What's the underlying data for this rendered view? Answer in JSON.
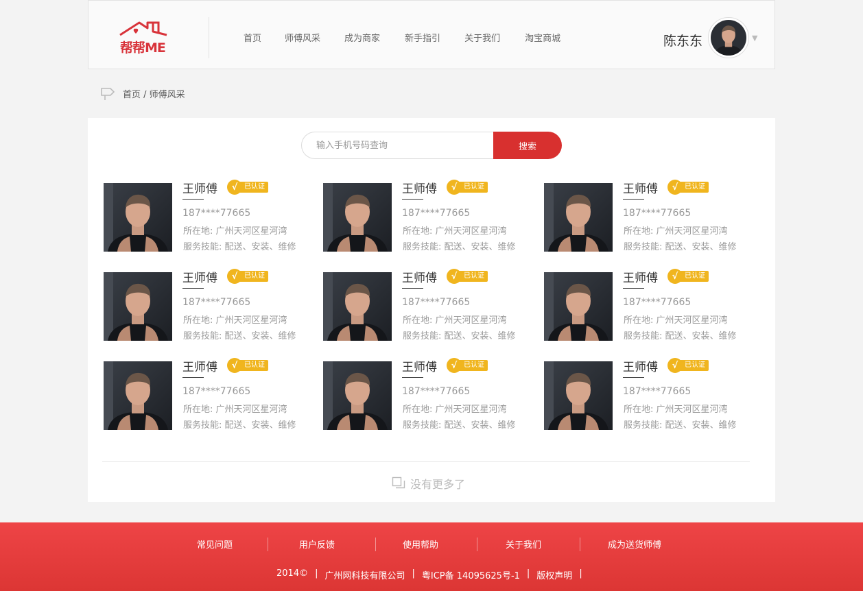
{
  "header": {
    "logo_text": "帮帮ME",
    "nav": [
      "首页",
      "师傅风采",
      "成为商家",
      "新手指引",
      "关于我们",
      "淘宝商城"
    ],
    "user_name": "陈东东"
  },
  "breadcrumb": "首页 / 师傅风采",
  "search": {
    "placeholder": "输入手机号码查询",
    "button": "搜索"
  },
  "badge_label": "已认证",
  "badge_mark": "√",
  "workers": [
    {
      "name": "王师傅",
      "phone": "187****77665",
      "address": "所在地: 广州天河区星河湾",
      "skills": "服务技能: 配送、安装、维修"
    },
    {
      "name": "王师傅",
      "phone": "187****77665",
      "address": "所在地: 广州天河区星河湾",
      "skills": "服务技能: 配送、安装、维修"
    },
    {
      "name": "王师傅",
      "phone": "187****77665",
      "address": "所在地: 广州天河区星河湾",
      "skills": "服务技能: 配送、安装、维修"
    },
    {
      "name": "王师傅",
      "phone": "187****77665",
      "address": "所在地: 广州天河区星河湾",
      "skills": "服务技能: 配送、安装、维修"
    },
    {
      "name": "王师傅",
      "phone": "187****77665",
      "address": "所在地: 广州天河区星河湾",
      "skills": "服务技能: 配送、安装、维修"
    },
    {
      "name": "王师傅",
      "phone": "187****77665",
      "address": "所在地: 广州天河区星河湾",
      "skills": "服务技能: 配送、安装、维修"
    },
    {
      "name": "王师傅",
      "phone": "187****77665",
      "address": "所在地: 广州天河区星河湾",
      "skills": "服务技能: 配送、安装、维修"
    },
    {
      "name": "王师傅",
      "phone": "187****77665",
      "address": "所在地: 广州天河区星河湾",
      "skills": "服务技能: 配送、安装、维修"
    },
    {
      "name": "王师傅",
      "phone": "187****77665",
      "address": "所在地: 广州天河区星河湾",
      "skills": "服务技能: 配送、安装、维修"
    }
  ],
  "no_more": "没有更多了",
  "footer": {
    "links": [
      "常见问题",
      "用户反馈",
      "使用帮助",
      "关于我们",
      "成为送货师傅"
    ],
    "copyright": "2014©",
    "company": "广州网科技有限公司",
    "icp": "粤ICP备 14095625号-1",
    "rights": "版权声明"
  },
  "colors": {
    "accent": "#d8302f",
    "badge": "#f0b51e",
    "footer": "#e53e3f"
  }
}
